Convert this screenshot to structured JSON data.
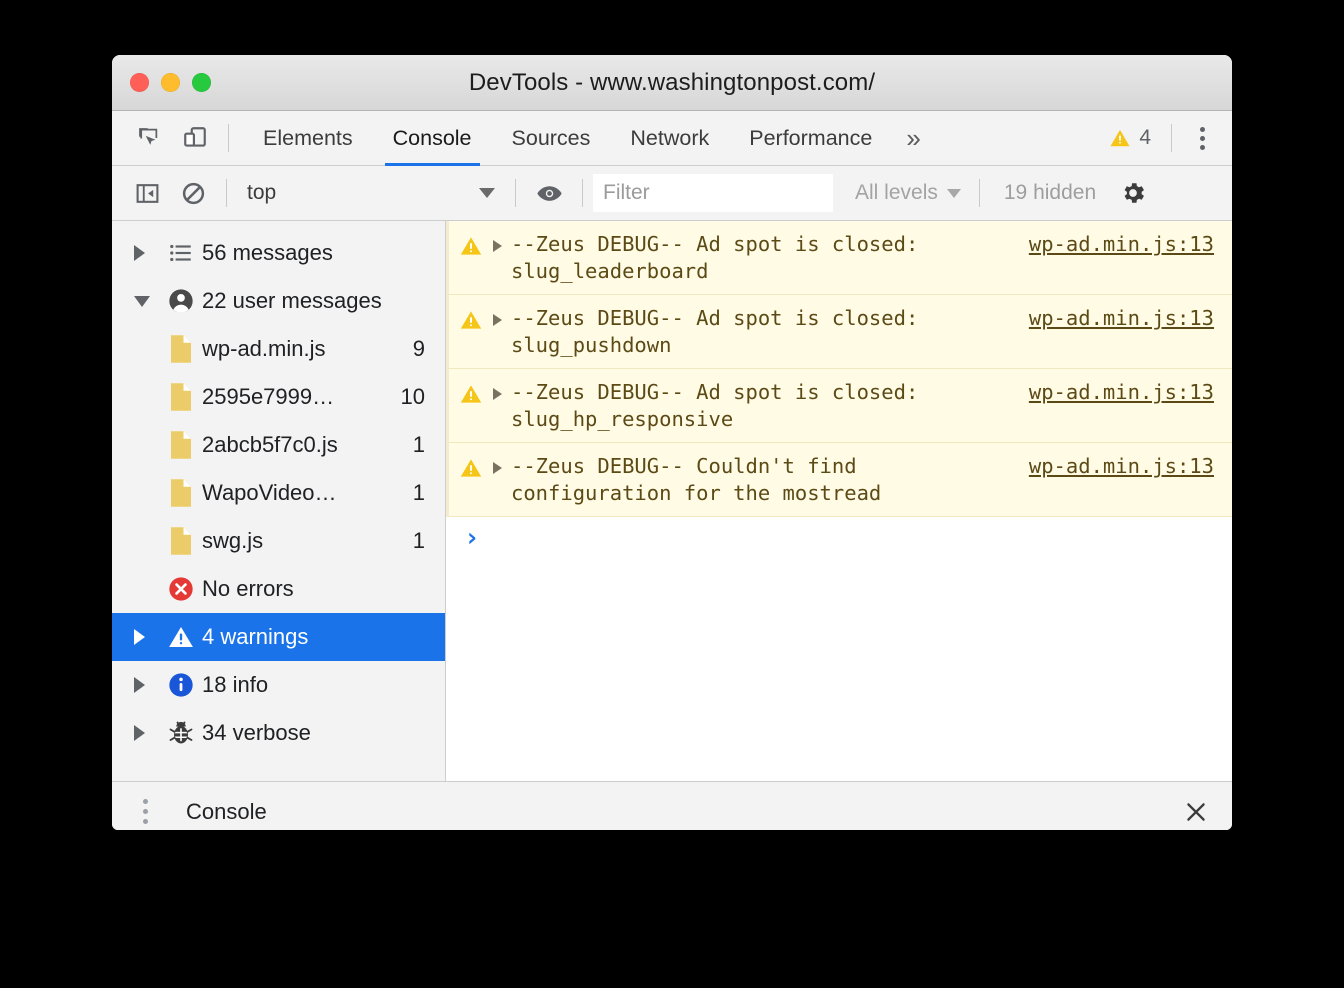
{
  "window": {
    "title": "DevTools - www.washingtonpost.com/",
    "traffic_lights": [
      "close",
      "minimize",
      "zoom"
    ]
  },
  "tabbar": {
    "inspect_icon": "inspect-element-icon",
    "device_icon": "device-toolbar-icon",
    "tabs": [
      {
        "label": "Elements",
        "active": false
      },
      {
        "label": "Console",
        "active": true
      },
      {
        "label": "Sources",
        "active": false
      },
      {
        "label": "Network",
        "active": false
      },
      {
        "label": "Performance",
        "active": false
      }
    ],
    "more_label": "»",
    "warning_count": "4",
    "warning_icon": "warning-triangle-icon",
    "menu_icon": "more-vertical-icon"
  },
  "toolbar": {
    "sidebar_toggle_icon": "console-sidebar-toggle-icon",
    "clear_icon": "clear-console-icon",
    "context": {
      "value": "top",
      "caret": "chevron-down-icon"
    },
    "live_expression_icon": "eye-icon",
    "filter": {
      "value": "",
      "placeholder": "Filter"
    },
    "levels": {
      "label": "All levels",
      "caret": "chevron-down-icon"
    },
    "hidden_label": "19 hidden",
    "settings_icon": "gear-icon"
  },
  "sidebar": {
    "items": [
      {
        "label": "56 messages",
        "count": "",
        "icon": "list-icon",
        "disclosure": "collapsed",
        "indent": 0,
        "selected": false
      },
      {
        "label": "22 user messages",
        "count": "",
        "icon": "user-icon",
        "disclosure": "expanded",
        "indent": 0,
        "selected": false
      },
      {
        "label": "wp-ad.min.js",
        "count": "9",
        "icon": "file-icon",
        "disclosure": "none",
        "indent": 1,
        "selected": false
      },
      {
        "label": "2595e7999…",
        "count": "10",
        "icon": "file-icon",
        "disclosure": "none",
        "indent": 1,
        "selected": false
      },
      {
        "label": "2abcb5f7c0.js",
        "count": "1",
        "icon": "file-icon",
        "disclosure": "none",
        "indent": 1,
        "selected": false
      },
      {
        "label": "WapoVideo…",
        "count": "1",
        "icon": "file-icon",
        "disclosure": "none",
        "indent": 1,
        "selected": false
      },
      {
        "label": "swg.js",
        "count": "1",
        "icon": "file-icon",
        "disclosure": "none",
        "indent": 1,
        "selected": false
      },
      {
        "label": "No errors",
        "count": "",
        "icon": "error-circle-icon",
        "disclosure": "none",
        "indent": 0,
        "selected": false
      },
      {
        "label": "4 warnings",
        "count": "",
        "icon": "warning-triangle-icon",
        "disclosure": "collapsed",
        "indent": 0,
        "selected": true
      },
      {
        "label": "18 info",
        "count": "",
        "icon": "info-circle-icon",
        "disclosure": "collapsed",
        "indent": 0,
        "selected": false
      },
      {
        "label": "34 verbose",
        "count": "",
        "icon": "bug-icon",
        "disclosure": "collapsed",
        "indent": 0,
        "selected": false
      }
    ]
  },
  "console": {
    "messages": [
      {
        "level": "warning",
        "icon": "warning-triangle-icon",
        "expand": "expand-arrow-icon",
        "text": "--Zeus DEBUG-- Ad spot is closed: slug_leaderboard",
        "source": "wp-ad.min.js:13"
      },
      {
        "level": "warning",
        "icon": "warning-triangle-icon",
        "expand": "expand-arrow-icon",
        "text": "--Zeus DEBUG-- Ad spot is closed: slug_pushdown",
        "source": "wp-ad.min.js:13"
      },
      {
        "level": "warning",
        "icon": "warning-triangle-icon",
        "expand": "expand-arrow-icon",
        "text": "--Zeus DEBUG-- Ad spot is closed: slug_hp_responsive",
        "source": "wp-ad.min.js:13"
      },
      {
        "level": "warning",
        "icon": "warning-triangle-icon",
        "expand": "expand-arrow-icon",
        "text": "--Zeus DEBUG-- Couldn't find configuration for the mostread",
        "source": "wp-ad.min.js:13"
      }
    ],
    "prompt_chevron": "›",
    "prompt_value": ""
  },
  "drawer": {
    "menu_icon": "more-vertical-icon",
    "tabs": [
      {
        "label": "Console",
        "active": true
      }
    ],
    "close_icon": "close-icon",
    "close_glyph": "✕"
  },
  "colors": {
    "accent": "#1a73e8",
    "warning": "#f5c518",
    "warning_bg": "#fffbe5",
    "warning_text": "#5c4a16",
    "error": "#e53935",
    "info": "#1a56d8",
    "toolbar_bg": "#f3f3f3",
    "file_icon": "#eccc68"
  }
}
